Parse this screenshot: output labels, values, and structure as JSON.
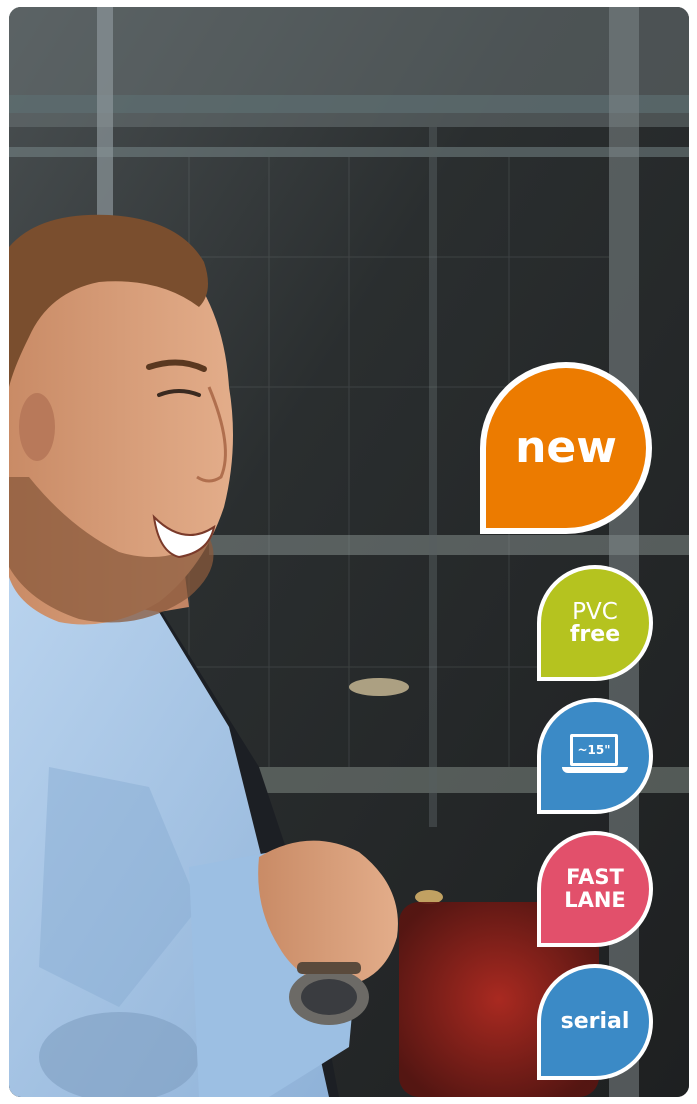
{
  "badges": {
    "new": {
      "label": "new",
      "color": "#ec7b00"
    },
    "pvc": {
      "line1": "PVC",
      "line2": "free",
      "color": "#b5c31f"
    },
    "laptop": {
      "icon": "laptop-icon",
      "label": "~15\"",
      "color": "#3b8ac6"
    },
    "fastlane": {
      "line1": "FAST",
      "line2": "LANE",
      "color": "#e2506b"
    },
    "serial": {
      "label": "serial",
      "color": "#3b8ac6"
    }
  },
  "photo": {
    "subject": "smiling-man-with-backpack",
    "shirt_color": "#a9c8e8",
    "background_color": "#2f3334"
  }
}
